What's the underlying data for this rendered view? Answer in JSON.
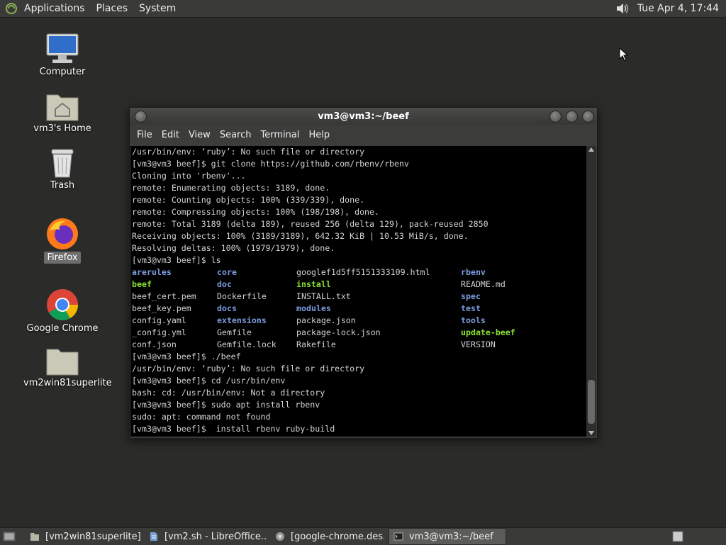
{
  "top_panel": {
    "menus": [
      "Applications",
      "Places",
      "System"
    ],
    "clock": "Tue Apr  4, 17:44"
  },
  "desktop": {
    "icons": [
      {
        "label": "Computer"
      },
      {
        "label": "vm3's Home"
      },
      {
        "label": "Trash"
      },
      {
        "label": "Firefox"
      },
      {
        "label": "Google Chrome"
      },
      {
        "label": "vm2win81superlite"
      }
    ]
  },
  "terminal": {
    "title": "vm3@vm3:~/beef",
    "menu": [
      "File",
      "Edit",
      "View",
      "Search",
      "Terminal",
      "Help"
    ],
    "lines_before": [
      "/usr/bin/env: ‘ruby’: No such file or directory",
      "[vm3@vm3 beef]$ git clone https://github.com/rbenv/rbenv",
      "Cloning into 'rbenv'...",
      "remote: Enumerating objects: 3189, done.",
      "remote: Counting objects: 100% (339/339), done.",
      "remote: Compressing objects: 100% (198/198), done.",
      "remote: Total 3189 (delta 189), reused 256 (delta 129), pack-reused 2850",
      "Receiving objects: 100% (3189/3189), 642.32 KiB | 10.53 MiB/s, done.",
      "Resolving deltas: 100% (1979/1979), done.",
      "[vm3@vm3 beef]$ ls"
    ],
    "ls_rows": [
      [
        {
          "t": "arerules",
          "k": "dir"
        },
        {
          "t": "core",
          "k": "dir"
        },
        {
          "t": "googlef1d5ff5151333109.html",
          "k": ""
        },
        {
          "t": "rbenv",
          "k": "dir"
        }
      ],
      [
        {
          "t": "beef",
          "k": "exe"
        },
        {
          "t": "doc",
          "k": "dir"
        },
        {
          "t": "install",
          "k": "exe"
        },
        {
          "t": "README.md",
          "k": ""
        }
      ],
      [
        {
          "t": "beef_cert.pem",
          "k": ""
        },
        {
          "t": "Dockerfile",
          "k": ""
        },
        {
          "t": "INSTALL.txt",
          "k": ""
        },
        {
          "t": "spec",
          "k": "dir"
        }
      ],
      [
        {
          "t": "beef_key.pem",
          "k": ""
        },
        {
          "t": "docs",
          "k": "dir"
        },
        {
          "t": "modules",
          "k": "dir"
        },
        {
          "t": "test",
          "k": "dir"
        }
      ],
      [
        {
          "t": "config.yaml",
          "k": ""
        },
        {
          "t": "extensions",
          "k": "dir"
        },
        {
          "t": "package.json",
          "k": ""
        },
        {
          "t": "tools",
          "k": "dir"
        }
      ],
      [
        {
          "t": "_config.yml",
          "k": ""
        },
        {
          "t": "Gemfile",
          "k": ""
        },
        {
          "t": "package-lock.json",
          "k": ""
        },
        {
          "t": "update-beef",
          "k": "exe"
        }
      ],
      [
        {
          "t": "conf.json",
          "k": ""
        },
        {
          "t": "Gemfile.lock",
          "k": ""
        },
        {
          "t": "Rakefile",
          "k": ""
        },
        {
          "t": "VERSION",
          "k": ""
        }
      ]
    ],
    "lines_after": [
      "[vm3@vm3 beef]$ ./beef",
      "/usr/bin/env: ‘ruby’: No such file or directory",
      "[vm3@vm3 beef]$ cd /usr/bin/env",
      "bash: cd: /usr/bin/env: Not a directory",
      "[vm3@vm3 beef]$ sudo apt install rbenv",
      "sudo: apt: command not found",
      "[vm3@vm3 beef]$  install rbenv ruby-build"
    ]
  },
  "taskbar": {
    "tasks": [
      {
        "label": "[vm2win81superlite]",
        "icon": "folder-icon"
      },
      {
        "label": "[vm2.sh - LibreOffice...",
        "icon": "document-icon"
      },
      {
        "label": "[google-chrome.des...",
        "icon": "chrome-icon"
      },
      {
        "label": "vm3@vm3:~/beef",
        "icon": "terminal-icon"
      }
    ]
  }
}
